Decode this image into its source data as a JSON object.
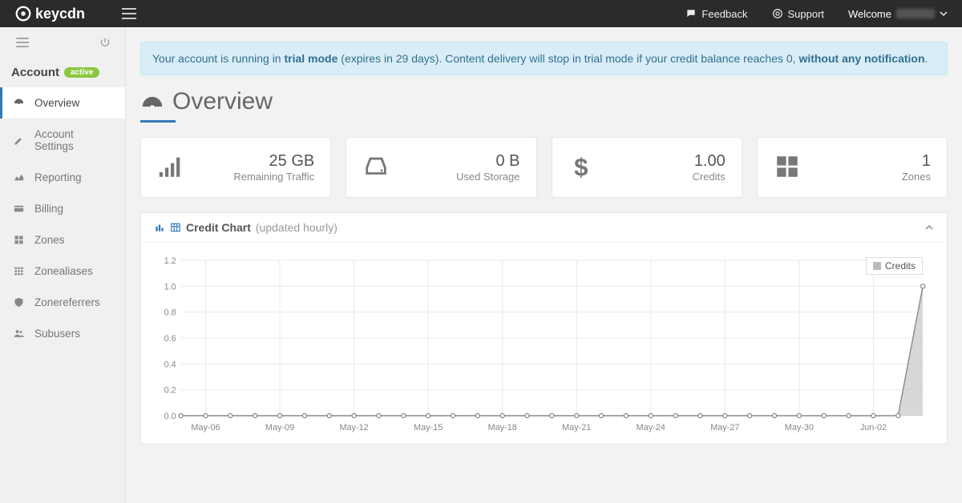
{
  "brand": "keycdn",
  "topbar": {
    "feedback": "Feedback",
    "support": "Support",
    "welcome": "Welcome"
  },
  "sidebar": {
    "section_title": "Account",
    "badge": "active",
    "items": [
      {
        "label": "Overview"
      },
      {
        "label": "Account Settings"
      },
      {
        "label": "Reporting"
      },
      {
        "label": "Billing"
      },
      {
        "label": "Zones"
      },
      {
        "label": "Zonealiases"
      },
      {
        "label": "Zonereferrers"
      },
      {
        "label": "Subusers"
      }
    ]
  },
  "notice": {
    "prefix": "Your account is running in ",
    "bold1": "trial mode",
    "mid": " (expires in 29 days). Content delivery will stop in trial mode if your credit balance reaches 0, ",
    "bold2": "without any notification",
    "suffix": "."
  },
  "page_title": "Overview",
  "stats": {
    "traffic": {
      "value": "25 GB",
      "label": "Remaining Traffic"
    },
    "storage": {
      "value": "0 B",
      "label": "Used Storage"
    },
    "credits": {
      "value": "1.00",
      "label": "Credits"
    },
    "zones": {
      "value": "1",
      "label": "Zones"
    }
  },
  "chart_panel": {
    "title": "Credit Chart",
    "subtitle": "(updated hourly)",
    "legend": "Credits"
  },
  "chart_data": {
    "type": "line",
    "ylabel": "",
    "xlabel": "",
    "ylim": [
      0,
      1.2
    ],
    "y_ticks": [
      0.0,
      0.2,
      0.4,
      0.6,
      0.8,
      1.0,
      1.2
    ],
    "x_tick_labels": [
      "May-06",
      "May-09",
      "May-12",
      "May-15",
      "May-18",
      "May-21",
      "May-24",
      "May-27",
      "May-30",
      "Jun-02"
    ],
    "series": [
      {
        "name": "Credits",
        "x": [
          "May-05",
          "May-06",
          "May-07",
          "May-08",
          "May-09",
          "May-10",
          "May-11",
          "May-12",
          "May-13",
          "May-14",
          "May-15",
          "May-16",
          "May-17",
          "May-18",
          "May-19",
          "May-20",
          "May-21",
          "May-22",
          "May-23",
          "May-24",
          "May-25",
          "May-26",
          "May-27",
          "May-28",
          "May-29",
          "May-30",
          "May-31",
          "Jun-01",
          "Jun-02",
          "Jun-03",
          "Jun-04"
        ],
        "values": [
          0,
          0,
          0,
          0,
          0,
          0,
          0,
          0,
          0,
          0,
          0,
          0,
          0,
          0,
          0,
          0,
          0,
          0,
          0,
          0,
          0,
          0,
          0,
          0,
          0,
          0,
          0,
          0,
          0,
          0,
          1.0
        ]
      }
    ]
  }
}
